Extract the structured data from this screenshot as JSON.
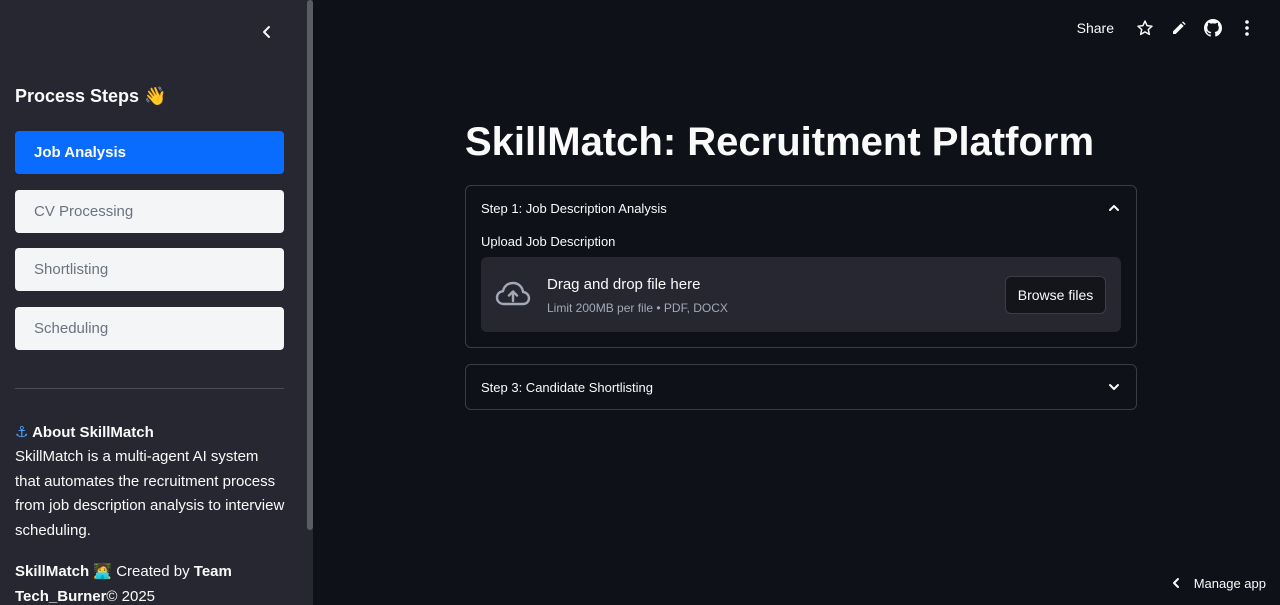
{
  "sidebar": {
    "title": "Process Steps",
    "title_emoji": "👋",
    "steps": [
      {
        "label": "Job Analysis",
        "active": true
      },
      {
        "label": "CV Processing",
        "active": false
      },
      {
        "label": "Shortlisting",
        "active": false
      },
      {
        "label": "Scheduling",
        "active": false
      }
    ],
    "about_emoji": "⚓",
    "about_title": "About SkillMatch",
    "about_text": "SkillMatch is a multi-agent AI system that automates the recruitment process from job description analysis to interview scheduling.",
    "footer": {
      "brand": "SkillMatch",
      "emoji": "🧑‍💻",
      "created_by": "Created by",
      "team": "Team Tech_Burner",
      "copyright": "© 2025"
    }
  },
  "toolbar": {
    "share_label": "Share",
    "icons": [
      "star-icon",
      "pencil-icon",
      "github-icon",
      "more-vertical-icon"
    ]
  },
  "main": {
    "title": "SkillMatch: Recruitment Platform",
    "expanders": [
      {
        "title": "Step 1: Job Description Analysis",
        "expanded": true,
        "upload_label": "Upload Job Description",
        "dropzone_title": "Drag and drop file here",
        "dropzone_subtitle": "Limit 200MB per file • PDF, DOCX",
        "browse_label": "Browse files"
      },
      {
        "title": "Step 3: Candidate Shortlisting",
        "expanded": false
      }
    ]
  },
  "manage_app_label": "Manage app",
  "colors": {
    "background": "#0e1117",
    "sidebar": "#262730",
    "accent": "#0a6cff"
  }
}
